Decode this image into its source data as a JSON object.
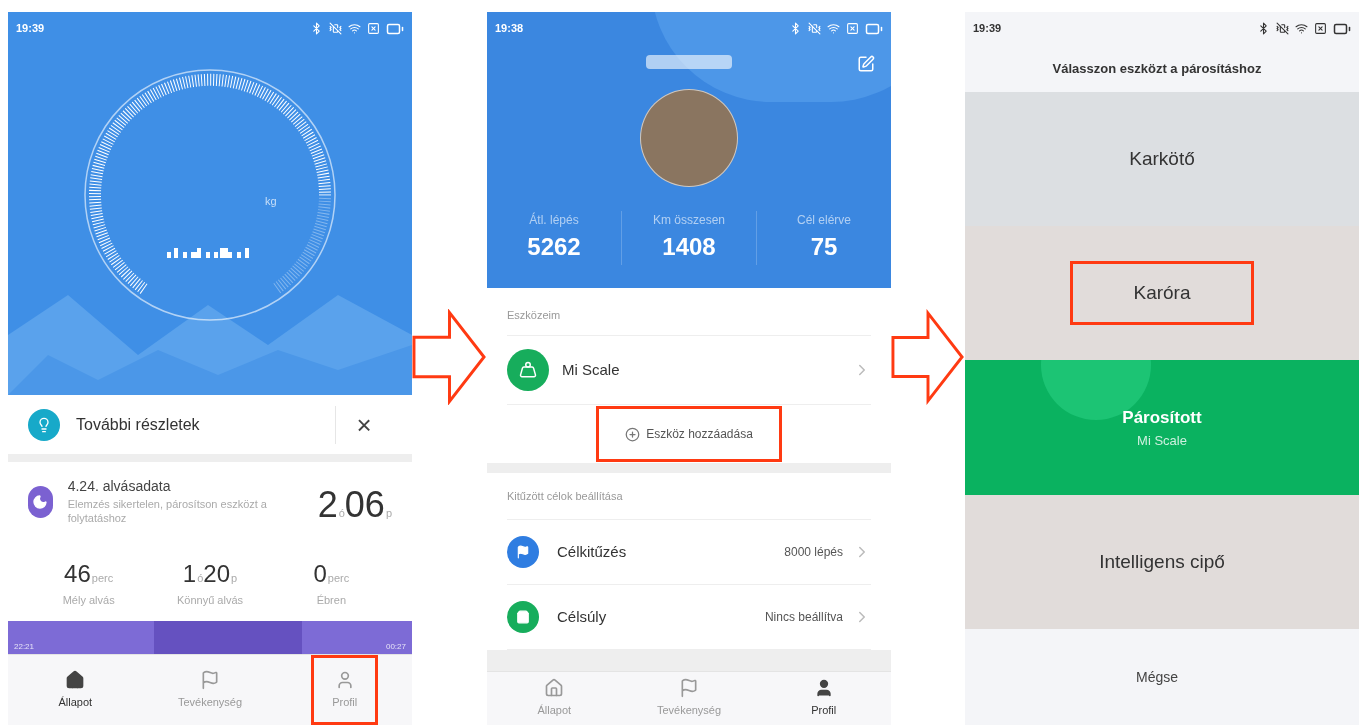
{
  "screen_1": {
    "status_bar": {
      "time": "19:39"
    },
    "gauge": {
      "unit": "kg"
    },
    "tip": {
      "text": "További részletek",
      "close": "×"
    },
    "sleep": {
      "title": "4.24. alvásadata",
      "description": "Elemzés sikertelen, párosítson eszközt a folytatáshoz",
      "total": [
        {
          "value": "2",
          "unit": "ó"
        },
        {
          "value": "06",
          "unit": "p"
        }
      ],
      "stats": [
        {
          "parts": [
            {
              "value": "46",
              "unit": "perc"
            }
          ],
          "label": "Mély alvás"
        },
        {
          "parts": [
            {
              "value": "1",
              "unit": "ó"
            },
            {
              "value": "20",
              "unit": "p"
            }
          ],
          "label": "Könnyű alvás"
        },
        {
          "parts": [
            {
              "value": "0",
              "unit": "perc"
            }
          ],
          "label": "Ébren"
        }
      ]
    },
    "timeline": {
      "start": "22:21",
      "end": "00:27"
    },
    "nav": [
      {
        "label": "Állapot",
        "kind": "home",
        "selected": true,
        "highlighted": false
      },
      {
        "label": "Tevékenység",
        "kind": "flag",
        "selected": false,
        "highlighted": false
      },
      {
        "label": "Profil",
        "kind": "person",
        "selected": false,
        "highlighted": true
      }
    ]
  },
  "screen_2": {
    "status_bar": {
      "time": "19:38"
    },
    "stats": [
      {
        "label": "Átl. lépés",
        "value": "5262"
      },
      {
        "label": "Km összesen",
        "value": "1408"
      },
      {
        "label": "Cél elérve",
        "value": "75"
      }
    ],
    "devices": {
      "heading": "Eszközeim",
      "items": [
        {
          "name": "Mi Scale"
        }
      ],
      "add_button": {
        "label": "Eszköz hozzáadása",
        "highlighted": true
      }
    },
    "goals": {
      "heading": "Kitűzött célok beállítása",
      "items": [
        {
          "label": "Célkitűzés",
          "value": "8000 lépés",
          "kind": "goal",
          "color": "#2f7de1"
        },
        {
          "label": "Célsúly",
          "value": "Nincs beállítva",
          "kind": "weight",
          "color": "#17ad5c"
        }
      ]
    },
    "nav": [
      {
        "label": "Állapot",
        "kind": "home",
        "selected": false,
        "highlighted": false
      },
      {
        "label": "Tevékenység",
        "kind": "flag",
        "selected": false,
        "highlighted": false
      },
      {
        "label": "Profil",
        "kind": "person",
        "selected": true,
        "highlighted": false
      }
    ]
  },
  "screen_3": {
    "status_bar": {
      "time": "19:39"
    },
    "title": "Válasszon eszközt a párosításhoz",
    "options": [
      {
        "label": "Karkötő",
        "kind": "plain",
        "highlighted": false
      },
      {
        "label": "Karóra",
        "kind": "plain",
        "highlighted": true
      },
      {
        "label": "Párosított",
        "sublabel": "Mi Scale",
        "kind": "paired",
        "highlighted": false
      },
      {
        "label": "Intelligens cipő",
        "kind": "plain",
        "highlighted": false
      }
    ],
    "cancel": "Mégse"
  }
}
